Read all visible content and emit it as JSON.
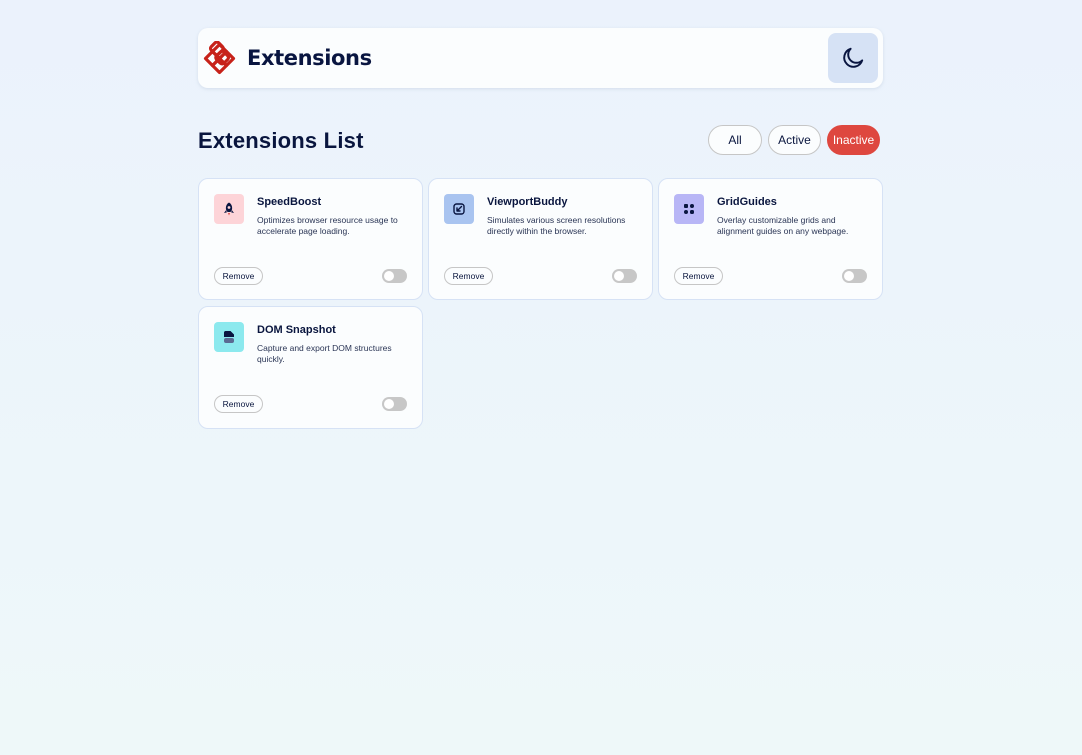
{
  "header": {
    "brand_name": "Extensions",
    "logo_icon": "extensions-logo-icon",
    "theme_icon": "moon-icon",
    "brand_color": "#c7221a"
  },
  "main": {
    "title": "Extensions List",
    "filters": [
      {
        "label": "All",
        "selected": false
      },
      {
        "label": "Active",
        "selected": false
      },
      {
        "label": "Inactive",
        "selected": true
      }
    ],
    "accent_color": "#de473f"
  },
  "extensions": [
    {
      "name": "SpeedBoost",
      "description": "Optimizes browser resource usage to accelerate page loading.",
      "icon": "rocket-icon",
      "icon_bg": "#fdd4d8",
      "remove_label": "Remove",
      "active": false
    },
    {
      "name": "ViewportBuddy",
      "description": "Simulates various screen resolutions directly within the browser.",
      "icon": "resize-arrow-icon",
      "icon_bg": "#a9c4f0",
      "remove_label": "Remove",
      "active": false
    },
    {
      "name": "GridGuides",
      "description": "Overlay customizable grids and alignment guides on any webpage.",
      "icon": "grid-icon",
      "icon_bg": "#b8b6f6",
      "remove_label": "Remove",
      "active": false
    },
    {
      "name": "DOM Snapshot",
      "description": "Capture and export DOM structures quickly.",
      "icon": "snapshot-icon",
      "icon_bg": "#8ce9ee",
      "remove_label": "Remove",
      "active": false
    }
  ]
}
